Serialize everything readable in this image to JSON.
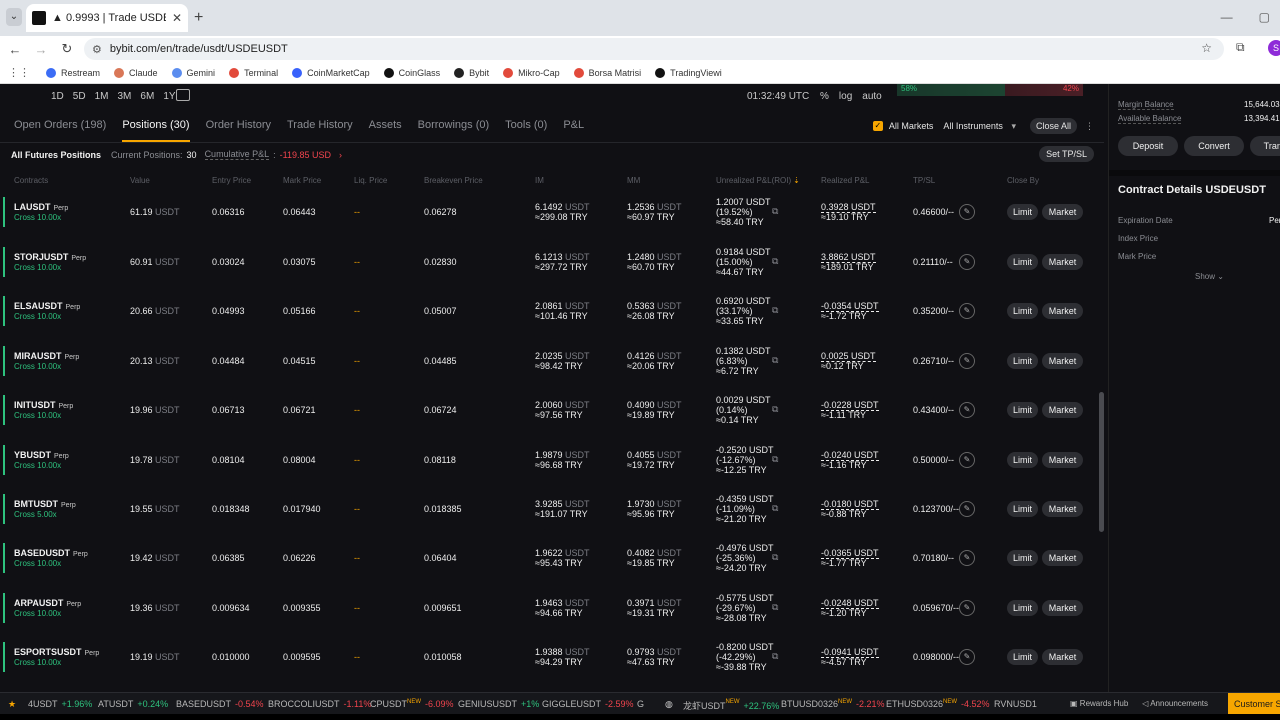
{
  "browser": {
    "tab_title": "▲ 0.9993 | Trade USDEUSDT | B",
    "url": "bybit.com/en/trade/usdt/USDEUSDT",
    "profile_initial": "S",
    "bookmarks": [
      "Restream",
      "Claude",
      "Gemini",
      "Terminal",
      "CoinMarketCap",
      "CoinGlass",
      "Bybit",
      "Mikro-Cap",
      "Borsa Matrisi",
      "TradingViewi"
    ]
  },
  "top_strip": {
    "timeframes": [
      "1D",
      "5D",
      "1M",
      "3M",
      "6M",
      "1Y"
    ],
    "clock": "01:32:49 UTC",
    "controls": [
      "%",
      "log",
      "auto"
    ],
    "buy_ratio": "58%",
    "sell_ratio": "42%"
  },
  "tabs": [
    "Open Orders (198)",
    "Positions (30)",
    "Order History",
    "Trade History",
    "Assets",
    "Borrowings (0)",
    "Tools (0)",
    "P&L"
  ],
  "filters": {
    "all_markets": "All Markets",
    "all_instruments": "All Instruments",
    "close_all": "Close All"
  },
  "summary": {
    "title": "All Futures Positions",
    "current_label": "Current Positions:",
    "current_value": "30",
    "cum_label": "Cumulative P&L",
    "cum_value": "-119.85 USD",
    "set_tpsl": "Set TP/SL"
  },
  "columns": [
    "Contracts",
    "Value",
    "Entry Price",
    "Mark Price",
    "Liq. Price",
    "Breakeven Price",
    "IM",
    "MM",
    "Unrealized P&L(ROI)",
    "Realized P&L",
    "TP/SL",
    "Close By"
  ],
  "positions": [
    {
      "symbol": "LAUSDT",
      "lev": "Cross 10.00x",
      "value": "61.19",
      "entry": "0.06316",
      "mark": "0.06443",
      "liq": "--",
      "be": "0.06278",
      "im1": "6.1492",
      "im2": "≈299.08 TRY",
      "mm1": "1.2536",
      "mm2": "≈60.97 TRY",
      "u1": "1.2007 USDT",
      "u2": "(19.52%)",
      "u3": "≈58.40 TRY",
      "ucls": "pos",
      "r1": "0.3928 USDT",
      "r2": "≈19.10 TRY",
      "rcls": "pos",
      "tp": "0.46600"
    },
    {
      "symbol": "STORJUSDT",
      "lev": "Cross 10.00x",
      "value": "60.91",
      "entry": "0.03024",
      "mark": "0.03075",
      "liq": "--",
      "be": "0.02830",
      "im1": "6.1213",
      "im2": "≈297.72 TRY",
      "mm1": "1.2480",
      "mm2": "≈60.70 TRY",
      "u1": "0.9184 USDT",
      "u2": "(15.00%)",
      "u3": "≈44.67 TRY",
      "ucls": "pos",
      "r1": "3.8862 USDT",
      "r2": "≈189.01 TRY",
      "rcls": "pos",
      "tp": "0.21110"
    },
    {
      "symbol": "ELSAUSDT",
      "lev": "Cross 10.00x",
      "value": "20.66",
      "entry": "0.04993",
      "mark": "0.05166",
      "liq": "--",
      "be": "0.05007",
      "im1": "2.0861",
      "im2": "≈101.46 TRY",
      "mm1": "0.5363",
      "mm2": "≈26.08 TRY",
      "u1": "0.6920 USDT",
      "u2": "(33.17%)",
      "u3": "≈33.65 TRY",
      "ucls": "pos",
      "r1": "-0.0354 USDT",
      "r2": "≈-1.72 TRY",
      "rcls": "neg",
      "tp": "0.35200"
    },
    {
      "symbol": "MIRAUSDT",
      "lev": "Cross 10.00x",
      "value": "20.13",
      "entry": "0.04484",
      "mark": "0.04515",
      "liq": "--",
      "be": "0.04485",
      "im1": "2.0235",
      "im2": "≈98.42 TRY",
      "mm1": "0.4126",
      "mm2": "≈20.06 TRY",
      "u1": "0.1382 USDT",
      "u2": "(6.83%)",
      "u3": "≈6.72 TRY",
      "ucls": "pos",
      "r1": "0.0025 USDT",
      "r2": "≈0.12 TRY",
      "rcls": "pos",
      "tp": "0.26710"
    },
    {
      "symbol": "INITUSDT",
      "lev": "Cross 10.00x",
      "value": "19.96",
      "entry": "0.06713",
      "mark": "0.06721",
      "liq": "--",
      "be": "0.06724",
      "im1": "2.0060",
      "im2": "≈97.56 TRY",
      "mm1": "0.4090",
      "mm2": "≈19.89 TRY",
      "u1": "0.0029 USDT",
      "u2": "(0.14%)",
      "u3": "≈0.14 TRY",
      "ucls": "pos",
      "r1": "-0.0228 USDT",
      "r2": "≈-1.11 TRY",
      "rcls": "neg",
      "tp": "0.43400"
    },
    {
      "symbol": "YBUSDT",
      "lev": "Cross 10.00x",
      "value": "19.78",
      "entry": "0.08104",
      "mark": "0.08004",
      "liq": "--",
      "be": "0.08118",
      "im1": "1.9879",
      "im2": "≈96.68 TRY",
      "mm1": "0.4055",
      "mm2": "≈19.72 TRY",
      "u1": "-0.2520 USDT",
      "u2": "(-12.67%)",
      "u3": "≈-12.25 TRY",
      "ucls": "neg",
      "r1": "-0.0240 USDT",
      "r2": "≈-1.16 TRY",
      "rcls": "neg",
      "tp": "0.50000"
    },
    {
      "symbol": "BMTUSDT",
      "lev": "Cross 5.00x",
      "value": "19.55",
      "entry": "0.018348",
      "mark": "0.017940",
      "liq": "--",
      "be": "0.018385",
      "im1": "3.9285",
      "im2": "≈191.07 TRY",
      "mm1": "1.9730",
      "mm2": "≈95.96 TRY",
      "u1": "-0.4359 USDT",
      "u2": "(-11.09%)",
      "u3": "≈-21.20 TRY",
      "ucls": "neg",
      "r1": "-0.0180 USDT",
      "r2": "≈-0.88 TRY",
      "rcls": "neg",
      "tp": "0.123700"
    },
    {
      "symbol": "BASEDUSDT",
      "lev": "Cross 10.00x",
      "value": "19.42",
      "entry": "0.06385",
      "mark": "0.06226",
      "liq": "--",
      "be": "0.06404",
      "im1": "1.9622",
      "im2": "≈95.43 TRY",
      "mm1": "0.4082",
      "mm2": "≈19.85 TRY",
      "u1": "-0.4976 USDT",
      "u2": "(-25.36%)",
      "u3": "≈-24.20 TRY",
      "ucls": "neg",
      "r1": "-0.0365 USDT",
      "r2": "≈-1.77 TRY",
      "rcls": "neg",
      "tp": "0.70180"
    },
    {
      "symbol": "ARPAUSDT",
      "lev": "Cross 10.00x",
      "value": "19.36",
      "entry": "0.009634",
      "mark": "0.009355",
      "liq": "--",
      "be": "0.009651",
      "im1": "1.9463",
      "im2": "≈94.66 TRY",
      "mm1": "0.3971",
      "mm2": "≈19.31 TRY",
      "u1": "-0.5775 USDT",
      "u2": "(-29.67%)",
      "u3": "≈-28.08 TRY",
      "ucls": "neg",
      "r1": "-0.0248 USDT",
      "r2": "≈-1.20 TRY",
      "rcls": "neg",
      "tp": "0.059670"
    },
    {
      "symbol": "ESPORTSUSDT",
      "lev": "Cross 10.00x",
      "value": "19.19",
      "entry": "0.010000",
      "mark": "0.009595",
      "liq": "--",
      "be": "0.010058",
      "im1": "1.9388",
      "im2": "≈94.29 TRY",
      "mm1": "0.9793",
      "mm2": "≈47.63 TRY",
      "u1": "-0.8200 USDT",
      "u2": "(-42.29%)",
      "u3": "≈-39.88 TRY",
      "ucls": "neg",
      "r1": "-0.0941 USDT",
      "r2": "≈-4.57 TRY",
      "rcls": "neg",
      "tp": "0.098000"
    }
  ],
  "labels": {
    "perp": "Perp",
    "usdt": "USDT",
    "tp_sep": "/--",
    "limit": "Limit",
    "market": "Market"
  },
  "side": {
    "margin_balance_label": "Margin Balance",
    "margin_balance_value": "15,644.0318",
    "available_balance_label": "Available Balance",
    "available_balance_value": "13,394.4126",
    "deposit": "Deposit",
    "convert": "Convert",
    "transfer": "Trans",
    "contract_title": "Contract Details USDEUSDT",
    "expiration_label": "Expiration Date",
    "expiration_value": "Per",
    "index_label": "Index Price",
    "mark_label": "Mark Price",
    "show": "Show"
  },
  "ticker": [
    {
      "sym": "4USDT",
      "ch": "+1.96%",
      "cls": "pos",
      "new": false
    },
    {
      "sym": "ATUSDT",
      "ch": "+0.24%",
      "cls": "pos",
      "new": false
    },
    {
      "sym": "BASEDUSDT",
      "ch": "-0.54%",
      "cls": "neg",
      "new": false
    },
    {
      "sym": "BROCCOLIUSDT",
      "ch": "-1.11%",
      "cls": "neg",
      "new": false
    },
    {
      "sym": "CPUSDT",
      "ch": "-6.09%",
      "cls": "neg",
      "new": true
    },
    {
      "sym": "GENIUSUSDT",
      "ch": "+1%",
      "cls": "pos",
      "new": false
    },
    {
      "sym": "GIGGLEUSDT",
      "ch": "-2.59%",
      "cls": "neg",
      "new": false
    },
    {
      "sym": "G",
      "ch": "",
      "cls": "neg",
      "new": false
    },
    {
      "sym": "龙虾USDT",
      "ch": "+22.76%",
      "cls": "pos",
      "new": true
    },
    {
      "sym": "BTUUSD0326",
      "ch": "-2.21%",
      "cls": "neg",
      "new": true
    },
    {
      "sym": "ETHUSD0326",
      "ch": "-4.52%",
      "cls": "neg",
      "new": true
    },
    {
      "sym": "RVNUSD1",
      "ch": "",
      "cls": "neg",
      "new": false
    }
  ],
  "ticker_right": [
    "Rewards Hub",
    "Announcements"
  ],
  "customer": "Customer S"
}
